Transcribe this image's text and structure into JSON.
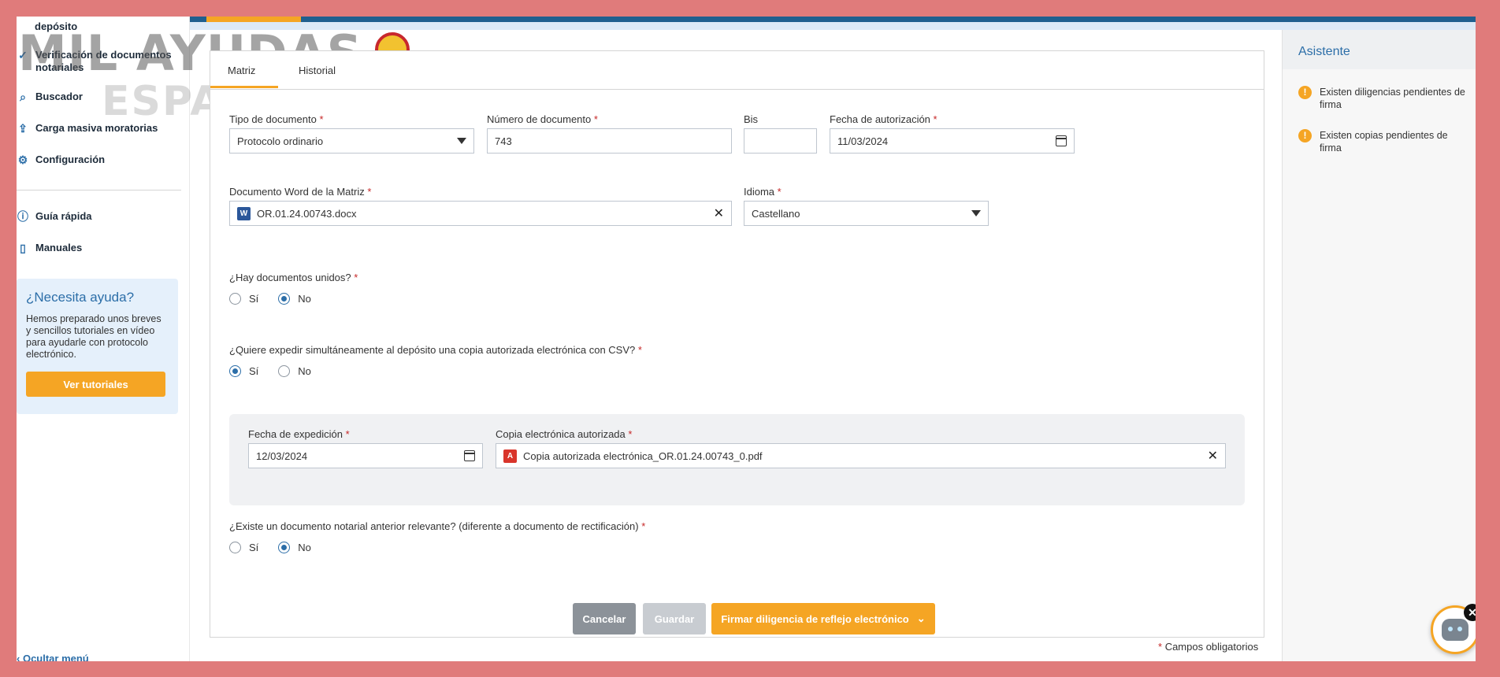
{
  "sidebar": {
    "items": [
      {
        "label": "depósito",
        "icon": "none"
      },
      {
        "label": "Verificación de documentos notariales",
        "icon": "verify-icon"
      },
      {
        "label": "Buscador",
        "icon": "search-icon"
      },
      {
        "label": "Carga masiva moratorias",
        "icon": "upload-icon"
      },
      {
        "label": "Configuración",
        "icon": "gear-icon"
      },
      {
        "label": "Guía rápida",
        "icon": "info-icon"
      },
      {
        "label": "Manuales",
        "icon": "book-icon"
      }
    ],
    "help": {
      "title": "¿Necesita ayuda?",
      "text": "Hemos preparado unos breves y sencillos tutoriales en vídeo para ayudarle con protocolo electrónico.",
      "button": "Ver tutoriales"
    },
    "hide_menu": "Ocultar menú"
  },
  "watermark": {
    "line1": "MIL AYUDAS",
    "line2": "ESPAÑA"
  },
  "tabs": [
    {
      "label": "Matriz"
    },
    {
      "label": "Historial"
    }
  ],
  "form": {
    "required_mark": "*",
    "tipo_documento": {
      "label": "Tipo de documento",
      "value": "Protocolo ordinario"
    },
    "numero_documento": {
      "label": "Número de documento",
      "value": "743"
    },
    "bis": {
      "label": "Bis",
      "value": ""
    },
    "fecha_autorizacion": {
      "label": "Fecha de autorización",
      "value": "11/03/2024"
    },
    "documento_word": {
      "label": "Documento Word de la Matriz",
      "value": "OR.01.24.00743.docx",
      "icon_text": "W"
    },
    "idioma": {
      "label": "Idioma",
      "value": "Castellano"
    },
    "documentos_unidos": {
      "label": "¿Hay documentos unidos?",
      "options": [
        "Sí",
        "No"
      ],
      "selected": "No"
    },
    "copia_csv": {
      "label": "¿Quiere expedir simultáneamente al depósito una copia autorizada electrónica con CSV?",
      "options": [
        "Sí",
        "No"
      ],
      "selected": "Sí"
    },
    "fecha_expedicion": {
      "label": "Fecha de expedición",
      "value": "12/03/2024"
    },
    "copia_electronica": {
      "label": "Copia electrónica autorizada",
      "value": "Copia autorizada electrónica_OR.01.24.00743_0.pdf",
      "icon_text": "A"
    },
    "documento_anterior": {
      "label": "¿Existe un documento notarial anterior relevante? (diferente a documento de rectificación)",
      "options": [
        "Sí",
        "No"
      ],
      "selected": "No"
    }
  },
  "actions": {
    "cancel": "Cancelar",
    "save": "Guardar",
    "sign": "Firmar diligencia de reflejo electrónico"
  },
  "footnote": {
    "mark": "*",
    "text": "Campos obligatorios"
  },
  "assistant": {
    "title": "Asistente",
    "warnings": [
      "Existen diligencias pendientes de firma",
      "Existen copias pendientes de firma"
    ]
  },
  "colors": {
    "accent": "#f5a524",
    "primary": "#2c6ea8",
    "frame": "#e07b7b",
    "required": "#c62828"
  }
}
